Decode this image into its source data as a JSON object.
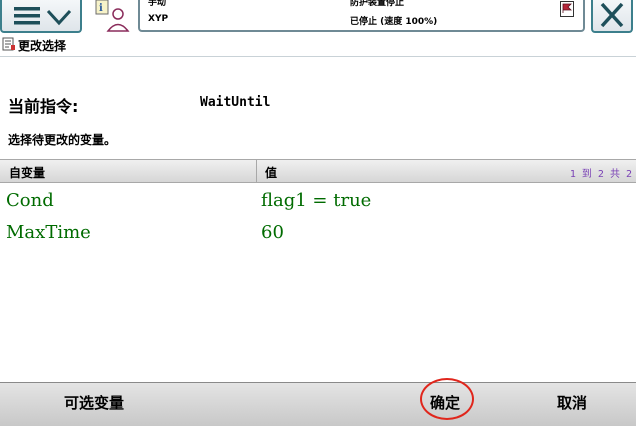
{
  "header": {
    "mode": "手动",
    "system": "XYP",
    "state": "防护装置停止",
    "speed": "已停止 (速度 100%)"
  },
  "window": {
    "title": "更改选择"
  },
  "instruction": {
    "label": "当前指令:",
    "value": "WaitUntil",
    "hint": "选择待更改的变量。"
  },
  "table": {
    "columns": [
      "自变量",
      "值"
    ],
    "pagination": "1 到 2 共 2",
    "rows": [
      {
        "name": "Cond",
        "value": "flag1 = true"
      },
      {
        "name": "MaxTime",
        "value": "60"
      }
    ]
  },
  "commands": {
    "optional_label": "可选变量",
    "ok_label": "确定",
    "cancel_label": "取消"
  },
  "colors": {
    "accent": "#3c7f8c",
    "value_text": "#006b00",
    "annotation_ring": "#e0261c",
    "pagination_text": "#7a42b5"
  },
  "icons": [
    "menu-icon",
    "chevron-down-icon",
    "info-person-icon",
    "flag-icon",
    "close-icon",
    "program-edit-icon"
  ]
}
